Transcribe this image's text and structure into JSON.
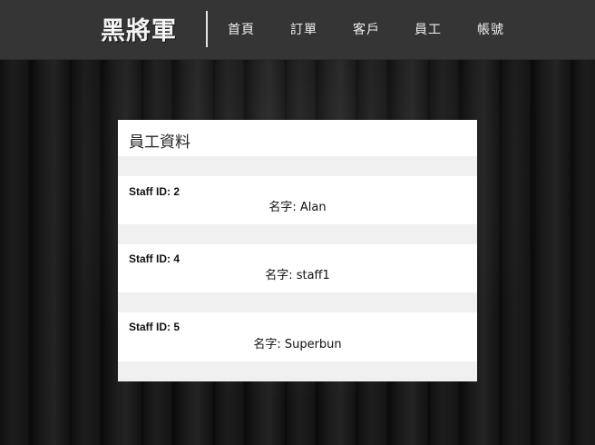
{
  "header": {
    "brand": "黑將軍",
    "nav": [
      {
        "label": "首頁"
      },
      {
        "label": "訂單"
      },
      {
        "label": "客戶"
      },
      {
        "label": "員工"
      },
      {
        "label": "帳號"
      }
    ]
  },
  "panel": {
    "title": "員工資料",
    "staff": [
      {
        "id_text": "Staff ID: 2",
        "name_text": "名字: Alan"
      },
      {
        "id_text": "Staff ID: 4",
        "name_text": "名字: staff1"
      },
      {
        "id_text": "Staff ID: 5",
        "name_text": "名字: Superbun"
      }
    ]
  },
  "colors": {
    "header_bg": "#353535",
    "panel_bg": "#ffffff",
    "stripe_bg": "#f0f0f0"
  }
}
